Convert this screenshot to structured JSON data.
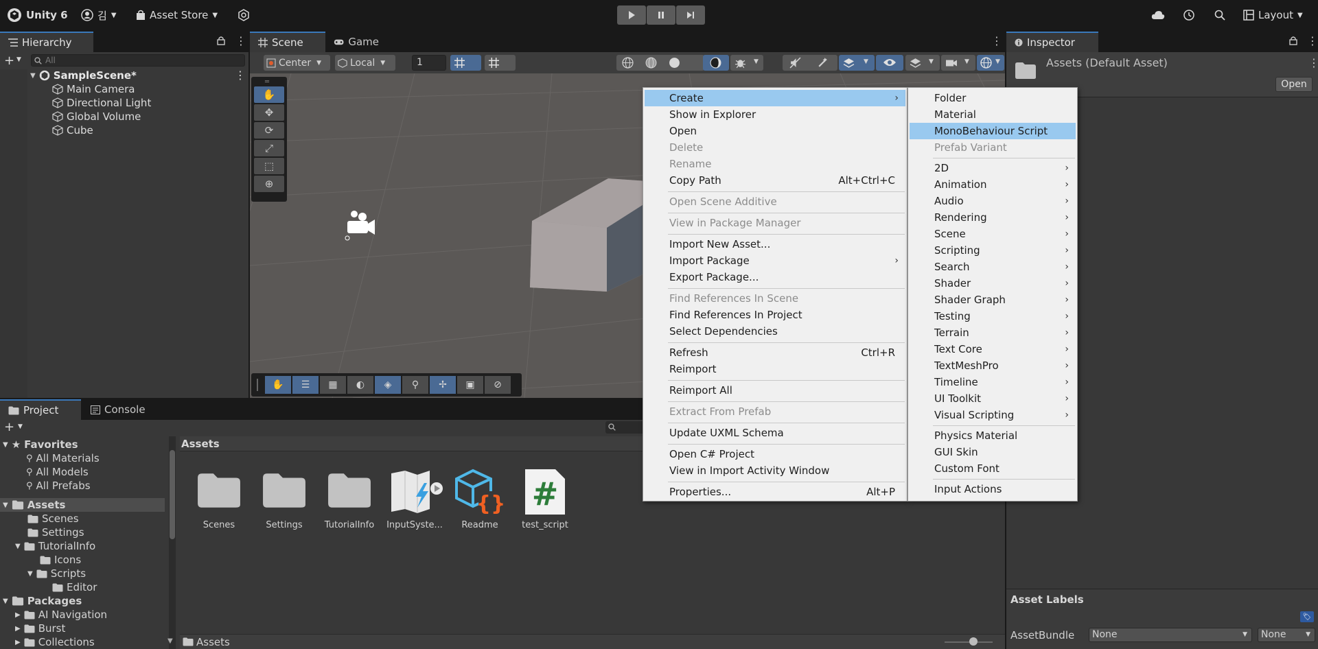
{
  "topbar": {
    "app_name": "Unity 6",
    "account": "김",
    "asset_store": "Asset Store",
    "layout": "Layout"
  },
  "hierarchy": {
    "tab": "Hierarchy",
    "search_placeholder": "All",
    "scene": "SampleScene*",
    "items": [
      "Main Camera",
      "Directional Light",
      "Global Volume",
      "Cube"
    ]
  },
  "scene_view": {
    "tabs": [
      "Scene",
      "Game"
    ],
    "pivot": "Center",
    "space": "Local",
    "snap_value": "1"
  },
  "inspector": {
    "tab": "Inspector",
    "title": "Assets (Default Asset)",
    "open_button": "Open",
    "asset_labels": "Asset Labels",
    "asset_bundle_label": "AssetBundle",
    "bundle_value": "None",
    "variant_value": "None"
  },
  "project": {
    "tabs": [
      "Project",
      "Console"
    ],
    "favorites": {
      "label": "Favorites",
      "items": [
        "All Materials",
        "All Models",
        "All Prefabs"
      ]
    },
    "assets_tree": {
      "label": "Assets",
      "items": [
        "Scenes",
        "Settings",
        "TutorialInfo",
        "Icons",
        "Scripts",
        "Editor"
      ]
    },
    "packages": {
      "label": "Packages",
      "items": [
        "AI Navigation",
        "Burst",
        "Collections"
      ]
    },
    "breadcrumb": "Assets",
    "footer_path": "Assets",
    "assets": [
      "Scenes",
      "Settings",
      "TutorialInfo",
      "InputSyste...",
      "Readme",
      "test_script"
    ]
  },
  "context_menu": {
    "items": [
      {
        "label": "Create",
        "submenu": true,
        "highlighted": true
      },
      {
        "label": "Show in Explorer"
      },
      {
        "label": "Open"
      },
      {
        "label": "Delete",
        "disabled": true
      },
      {
        "label": "Rename",
        "disabled": true
      },
      {
        "label": "Copy Path",
        "shortcut": "Alt+Ctrl+C"
      },
      {
        "label": "Open Scene Additive",
        "disabled": true
      },
      {
        "label": "View in Package Manager",
        "disabled": true
      },
      {
        "label": "Import New Asset..."
      },
      {
        "label": "Import Package",
        "submenu": true
      },
      {
        "label": "Export Package..."
      },
      {
        "label": "Find References In Scene",
        "disabled": true
      },
      {
        "label": "Find References In Project"
      },
      {
        "label": "Select Dependencies"
      },
      {
        "label": "Refresh",
        "shortcut": "Ctrl+R"
      },
      {
        "label": "Reimport"
      },
      {
        "label": "Reimport All"
      },
      {
        "label": "Extract From Prefab",
        "disabled": true
      },
      {
        "label": "Update UXML Schema"
      },
      {
        "label": "Open C# Project"
      },
      {
        "label": "View in Import Activity Window"
      },
      {
        "label": "Properties...",
        "shortcut": "Alt+P"
      }
    ]
  },
  "create_submenu": {
    "items": [
      {
        "label": "Folder"
      },
      {
        "label": "Material"
      },
      {
        "label": "MonoBehaviour Script",
        "highlighted": true
      },
      {
        "label": "Prefab Variant",
        "disabled": true
      },
      {
        "label": "2D",
        "submenu": true
      },
      {
        "label": "Animation",
        "submenu": true
      },
      {
        "label": "Audio",
        "submenu": true
      },
      {
        "label": "Rendering",
        "submenu": true
      },
      {
        "label": "Scene",
        "submenu": true
      },
      {
        "label": "Scripting",
        "submenu": true
      },
      {
        "label": "Search",
        "submenu": true
      },
      {
        "label": "Shader",
        "submenu": true
      },
      {
        "label": "Shader Graph",
        "submenu": true
      },
      {
        "label": "Testing",
        "submenu": true
      },
      {
        "label": "Terrain",
        "submenu": true
      },
      {
        "label": "Text Core",
        "submenu": true
      },
      {
        "label": "TextMeshPro",
        "submenu": true
      },
      {
        "label": "Timeline",
        "submenu": true
      },
      {
        "label": "UI Toolkit",
        "submenu": true
      },
      {
        "label": "Visual Scripting",
        "submenu": true
      },
      {
        "label": "Physics Material"
      },
      {
        "label": "GUI Skin"
      },
      {
        "label": "Custom Font"
      },
      {
        "label": "Input Actions"
      }
    ]
  },
  "colors": {
    "accent": "#3a79bb",
    "menu_highlight": "#99c9ef",
    "panel_bg": "#383838",
    "titlebar_bg": "#191919"
  }
}
